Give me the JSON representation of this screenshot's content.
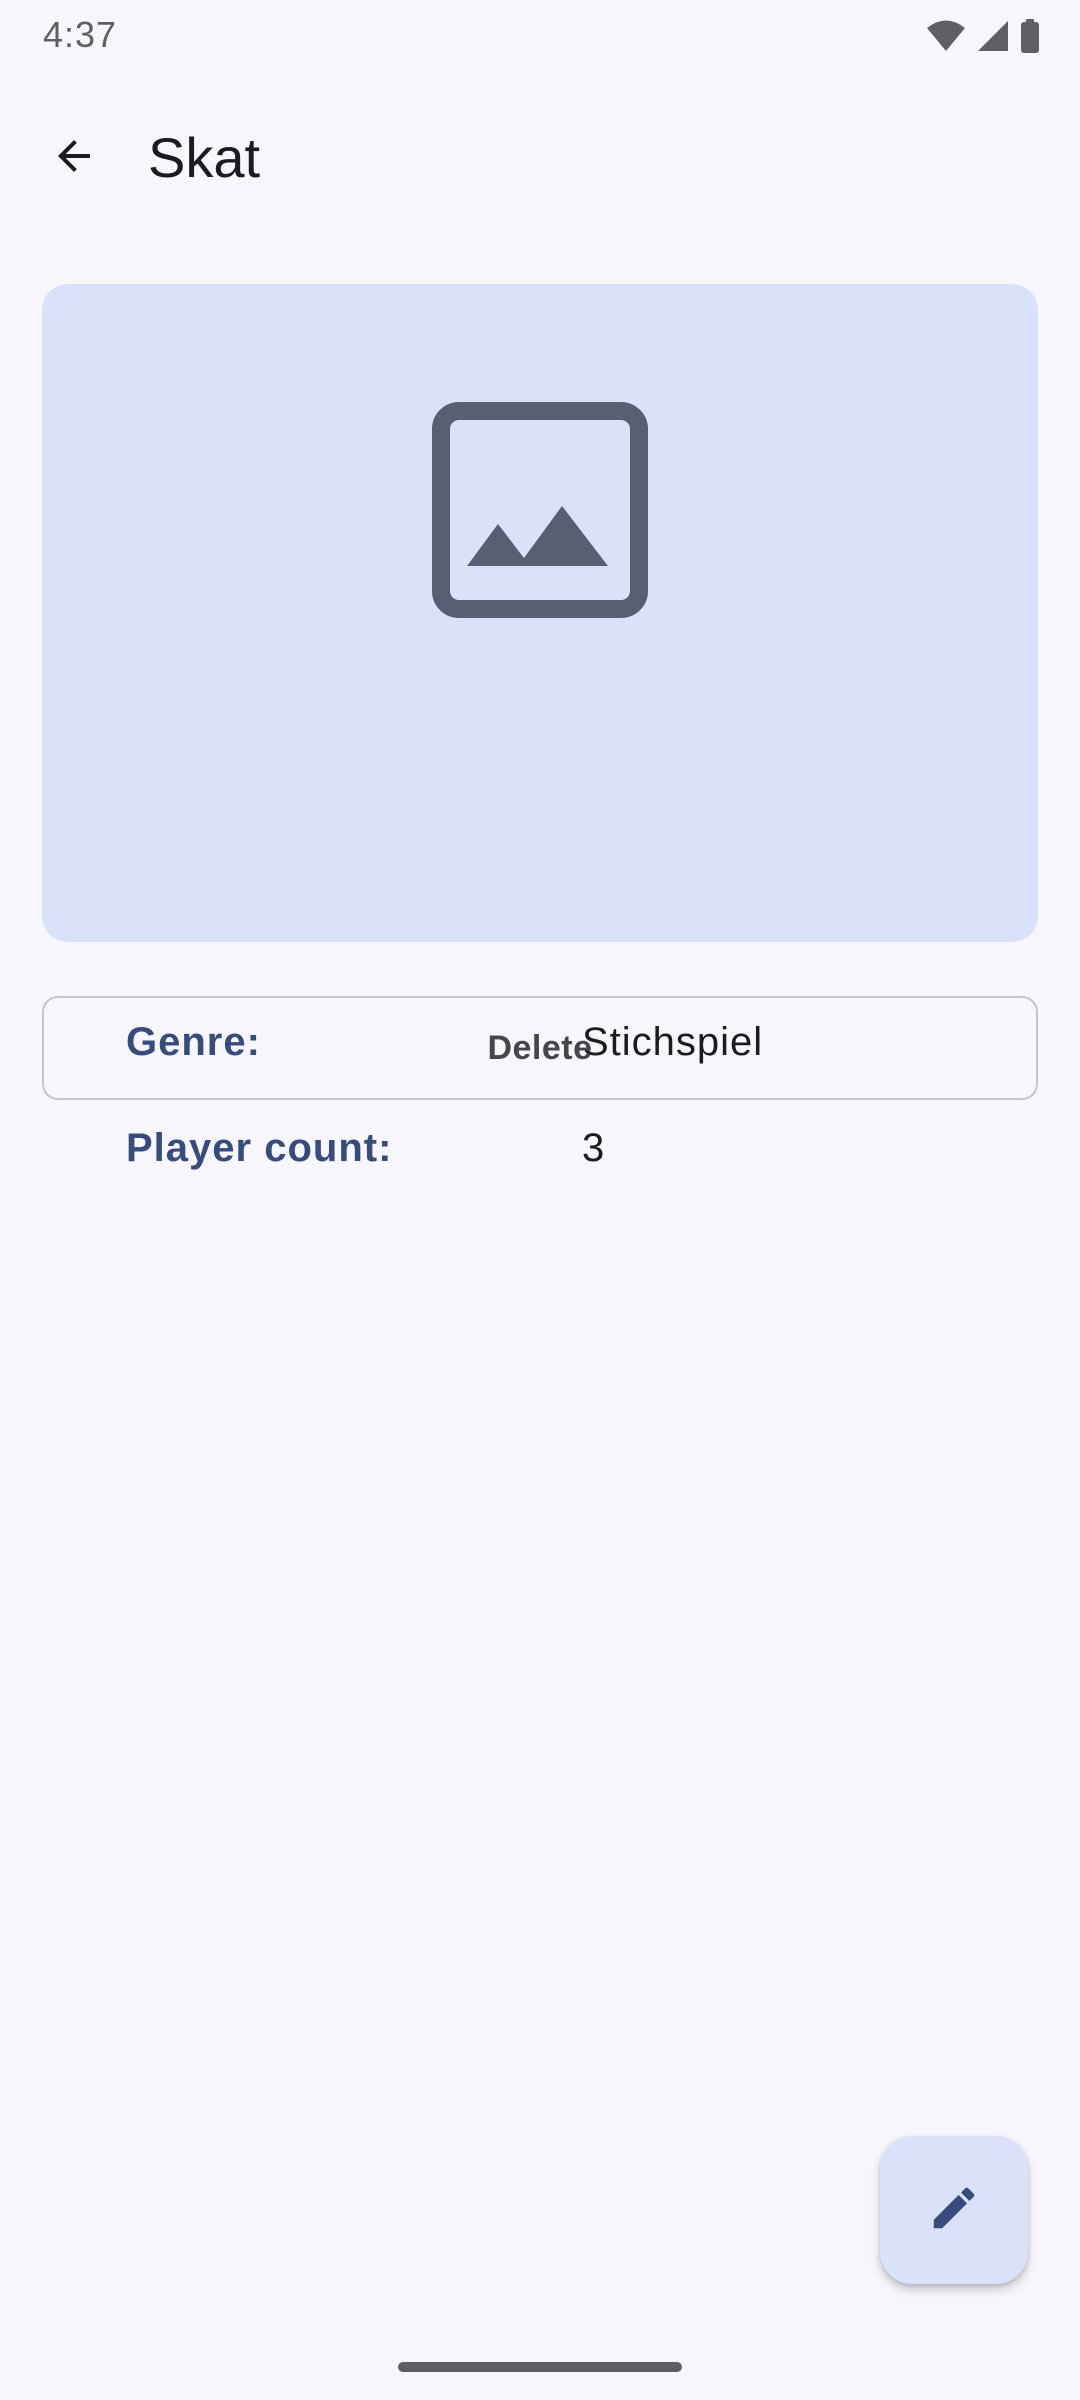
{
  "status_bar": {
    "time": "4:37",
    "icons": [
      "wifi-icon",
      "cellular-signal-icon",
      "battery-icon"
    ]
  },
  "top_bar": {
    "back_icon": "arrow-back-icon",
    "title": "Skat"
  },
  "game_card": {
    "image_icon": "image-placeholder-icon",
    "genre_label": "Genre:",
    "genre_value": "Stichspiel",
    "player_count_label": "Player count:",
    "player_count_value": "3"
  },
  "actions": {
    "delete_label": "Delete",
    "edit_icon": "pencil-edit-icon"
  },
  "colors": {
    "background": "#f8f6fd",
    "card": "#dae1fb",
    "label_accent": "#354c7d",
    "icon_dark": "#575f73"
  }
}
